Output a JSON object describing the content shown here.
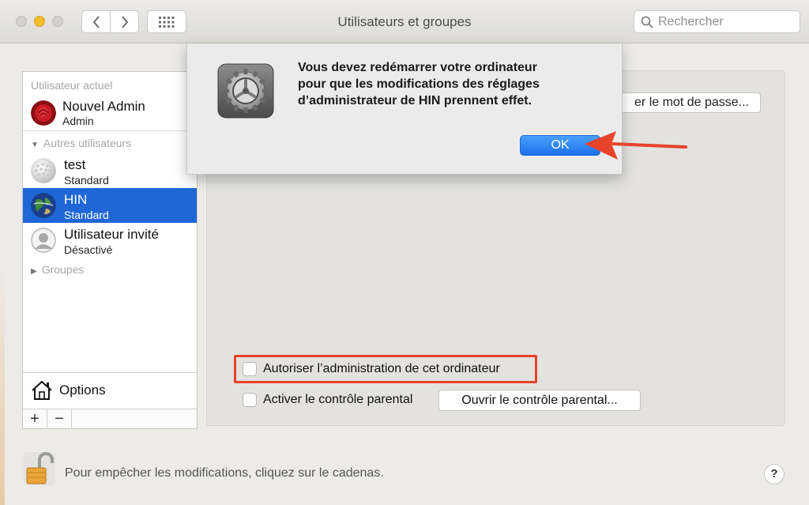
{
  "window": {
    "title": "Utilisateurs et groupes",
    "search_placeholder": "Rechercher"
  },
  "sidebar": {
    "current_user_header": "Utilisateur actuel",
    "current_user": {
      "name": "Nouvel Admin",
      "role": "Admin"
    },
    "other_users_header": "Autres utilisateurs",
    "users": [
      {
        "name": "test",
        "role": "Standard",
        "selected": false
      },
      {
        "name": "HIN",
        "role": "Standard",
        "selected": true
      },
      {
        "name": "Utilisateur invité",
        "role": "Désactivé",
        "selected": false
      }
    ],
    "groups_header": "Groupes",
    "options_label": "Options",
    "add_label": "+",
    "remove_label": "−"
  },
  "pane": {
    "password_button": "er le mot de passe...",
    "allow_admin_label": "Autoriser l’administration de cet ordinateur",
    "allow_admin_checked": false,
    "parental_label": "Activer le contrôle parental",
    "parental_checked": false,
    "parental_button": "Ouvrir le contrôle parental..."
  },
  "footer": {
    "lock_text": "Pour empêcher les modifications, cliquez sur le cadenas.",
    "help_label": "?"
  },
  "dialog": {
    "message_lines": [
      "Vous devez redémarrer votre ordinateur",
      "pour que les modifications des réglages",
      "d’administrateur de HIN prennent effet."
    ],
    "ok_label": "OK",
    "icon": "gear-icon"
  },
  "colors": {
    "selection": "#1f67d6",
    "ok_button": "#1c71ea",
    "annotation": "#e8432b"
  }
}
